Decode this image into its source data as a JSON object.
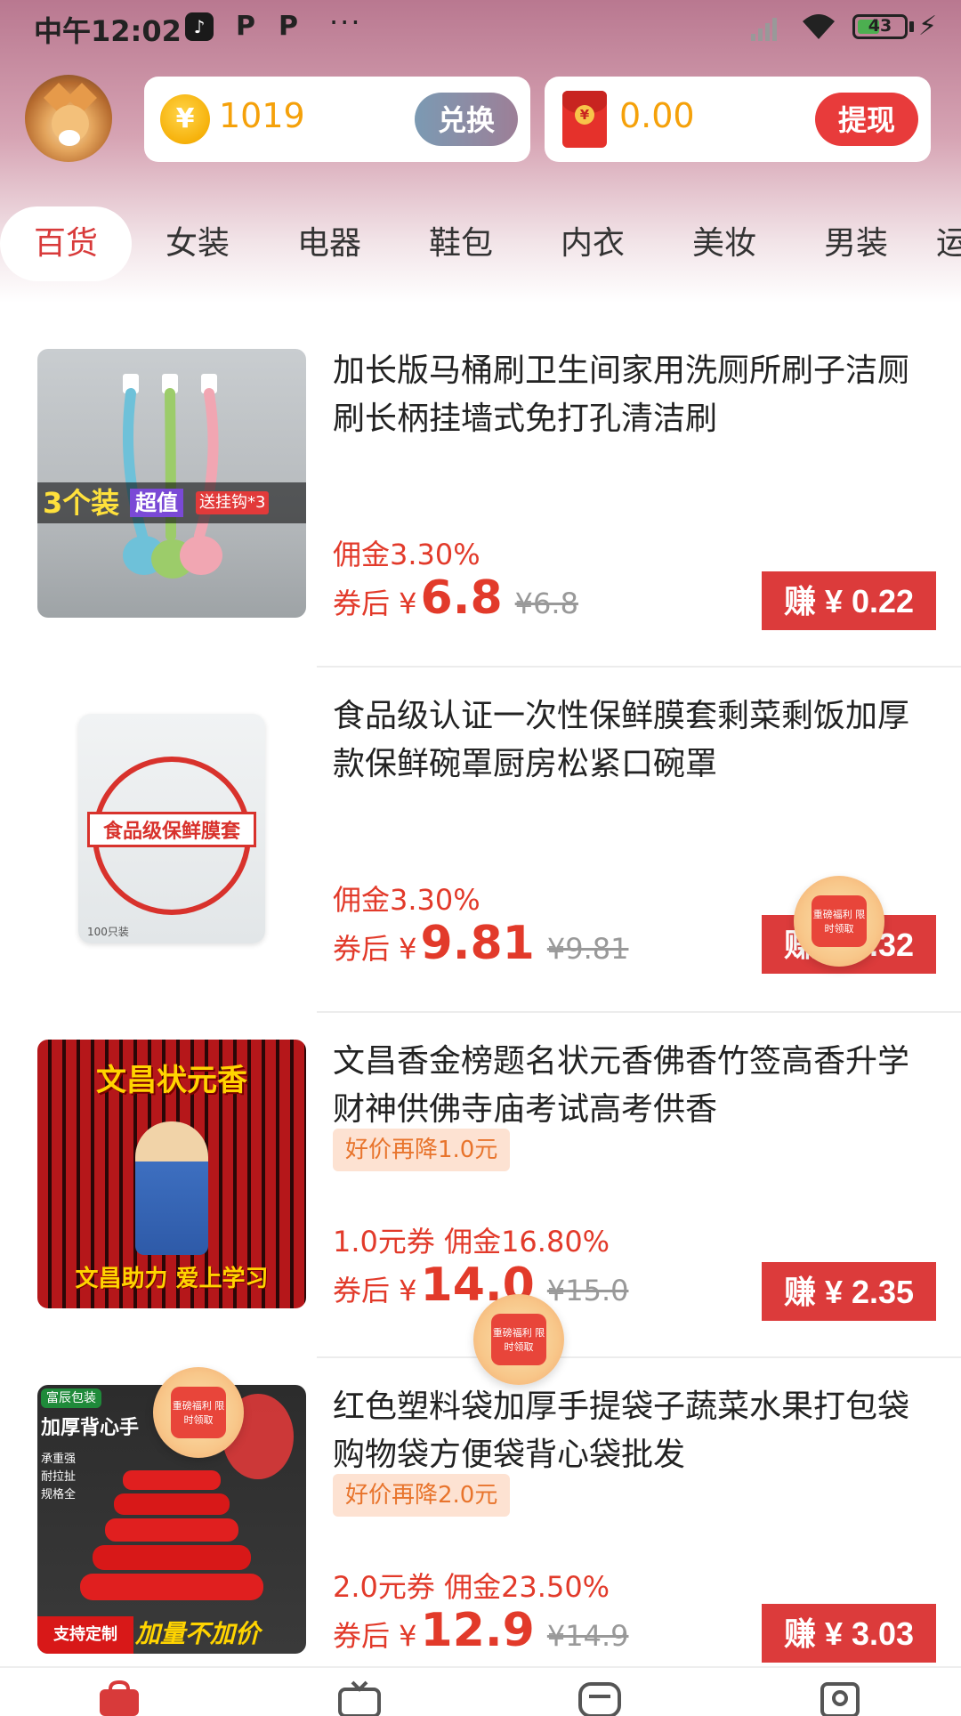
{
  "status_bar": {
    "time": "中午12:02",
    "battery": "43",
    "app_icons": [
      "tiktok-icon",
      "p-app-icon",
      "p-app-icon"
    ],
    "more": "···"
  },
  "top": {
    "coins": "1019",
    "coin_symbol": "¥",
    "exchange_label": "兑换",
    "cash": "0.00",
    "withdraw_label": "提现"
  },
  "tabs": [
    "百货",
    "女装",
    "电器",
    "鞋包",
    "内衣",
    "美妆",
    "男装",
    "运"
  ],
  "active_tab": 0,
  "products": [
    {
      "title": "加长版马桶刷卫生间家用洗厕所刷子洁厕刷长柄挂墙式免打孔清洁刷",
      "thumb_text": [
        "3个装",
        "超值",
        "送挂钩*3"
      ],
      "promo": "",
      "meta": "佣金3.30%",
      "price_prefix": "券后 ¥",
      "price": "6.8",
      "original": "¥6.8",
      "earn": "赚 ¥ 0.22"
    },
    {
      "title": "食品级认证一次性保鲜膜套剩菜剩饭加厚款保鲜碗罩厨房松紧口碗罩",
      "thumb_text": [
        "食品级保鲜膜套",
        "100只装"
      ],
      "promo": "",
      "meta": "佣金3.30%",
      "price_prefix": "券后 ¥",
      "price": "9.81",
      "original": "¥9.81",
      "earn": "赚 ¥ 0.32"
    },
    {
      "title": "文昌香金榜题名状元香佛香竹签高香升学财神供佛寺庙考试高考供香",
      "thumb_text": [
        "文昌状元香",
        "文昌助力 爱上学习"
      ],
      "promo": "好价再降1.0元",
      "meta": "1.0元券 佣金16.80%",
      "price_prefix": "券后 ¥",
      "price": "14.0",
      "original": "¥15.0",
      "earn": "赚 ¥ 2.35"
    },
    {
      "title": "红色塑料袋加厚手提袋子蔬菜水果打包袋购物袋方便袋背心袋批发",
      "thumb_text": [
        "富辰包装",
        "加厚背心手",
        "承重强",
        "耐拉扯",
        "规格全",
        "支持定制",
        "加量不加价"
      ],
      "promo": "好价再降2.0元",
      "meta": "2.0元券 佣金23.50%",
      "price_prefix": "券后 ¥",
      "price": "12.9",
      "original": "¥14.9",
      "earn": "赚 ¥ 3.03"
    }
  ],
  "float_badge_text": "重磅福利 限时领取",
  "colors": {
    "accent_red": "#e23a2a",
    "earn_button": "#dc3b3b",
    "coin_gold": "#f5a10a",
    "promo_bg": "#fde2d2",
    "promo_text": "#e8742c"
  },
  "bottom_nav_icons": [
    "shopping-bag-icon",
    "tv-icon",
    "message-icon",
    "profile-icon"
  ]
}
